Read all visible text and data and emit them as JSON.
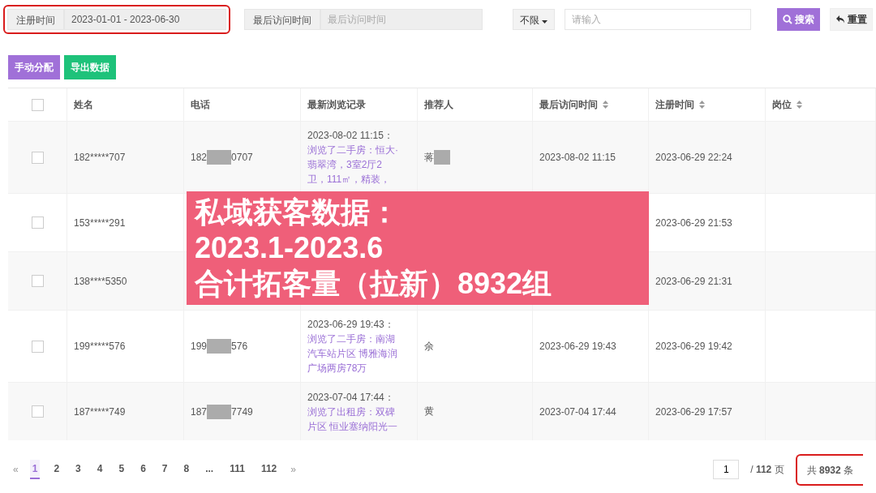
{
  "filters": [
    {
      "kind": "range",
      "label": "注册时间",
      "value": "2023-01-01 - 2023-06-30",
      "highlighted": true
    },
    {
      "kind": "range",
      "label": "最后访问时间",
      "placeholder": "最后访问时间",
      "highlighted": false
    }
  ],
  "search": {
    "dropdown": "不限",
    "placeholder": "请输入"
  },
  "top_buttons": [
    {
      "kind": "search",
      "label": "搜索"
    },
    {
      "kind": "reset",
      "label": "重置"
    }
  ],
  "actions": [
    {
      "label": "手动分配",
      "color": "#a070d8"
    },
    {
      "label": "导出数据",
      "color": "#1ec27a"
    }
  ],
  "table": {
    "columns": [
      {
        "kind": "check",
        "checked": false
      },
      {
        "kind": "text",
        "label": "姓名",
        "sortable": false
      },
      {
        "kind": "text",
        "label": "电话",
        "sortable": false
      },
      {
        "kind": "text",
        "label": "最新浏览记录",
        "sortable": false
      },
      {
        "kind": "text",
        "label": "推荐人",
        "sortable": false
      },
      {
        "kind": "text",
        "label": "最后访问时间",
        "sortable": true
      },
      {
        "kind": "text",
        "label": "注册时间",
        "sortable": true
      },
      {
        "kind": "text",
        "label": "岗位",
        "sortable": true
      }
    ],
    "rows": [
      {
        "checked": false,
        "name": "182*****707",
        "phone_start": "182",
        "phone_end": "0707",
        "record_time": "2023-08-02 11:15：",
        "record_lines": [
          "浏览了二手房：恒大·",
          "翡翠湾，3室2厅2",
          "卫，111㎡，精装，"
        ],
        "referrer": "蒋",
        "referrer_redacted": true,
        "last_visit": "2023-08-02 11:15",
        "registered": "2023-06-29 22:24"
      },
      {
        "checked": false,
        "name": "153*****291",
        "registered": "2023-06-29 21:53"
      },
      {
        "checked": false,
        "name": "138****5350",
        "registered": "2023-06-29 21:31"
      },
      {
        "checked": false,
        "name": "199*****576",
        "phone_start": "199",
        "phone_end": "576",
        "record_time": "2023-06-29 19:43：",
        "record_lines": [
          "浏览了二手房：南湖",
          "汽车站片区 博雅海润",
          "广场两房78万"
        ],
        "referrer": "余",
        "referrer_redacted": false,
        "last_visit": "2023-06-29 19:43",
        "registered": "2023-06-29 19:42"
      },
      {
        "checked": false,
        "name": "187*****749",
        "phone_start": "187",
        "phone_end": "7749",
        "record_time": "2023-07-04 17:44：",
        "record_lines": [
          "浏览了出租房：双碑",
          "片区 恒业塞纳阳光一"
        ],
        "referrer": "黄",
        "referrer_redacted": false,
        "last_visit": "2023-07-04 17:44",
        "registered": "2023-06-29 17:57"
      }
    ]
  },
  "overlay": {
    "lines": [
      "私域获客数据：",
      "2023.1-2023.6",
      "合计拓客量（拉新）8932组"
    ]
  },
  "pagination": {
    "prev": "«",
    "next": "»",
    "pages": [
      {
        "label": "1",
        "selected": true
      },
      {
        "label": "2",
        "selected": false
      },
      {
        "label": "3",
        "selected": false
      },
      {
        "label": "4",
        "selected": false
      },
      {
        "label": "5",
        "selected": false
      },
      {
        "label": "6",
        "selected": false
      },
      {
        "label": "7",
        "selected": false
      },
      {
        "label": "8",
        "selected": false
      },
      {
        "label": "...",
        "selected": false
      },
      {
        "label": "111",
        "selected": false
      },
      {
        "label": "112",
        "selected": false
      }
    ],
    "page_input": "1",
    "page_total": "/ **112** 页",
    "total": "共 **8932** 条",
    "total_highlighted": true
  }
}
